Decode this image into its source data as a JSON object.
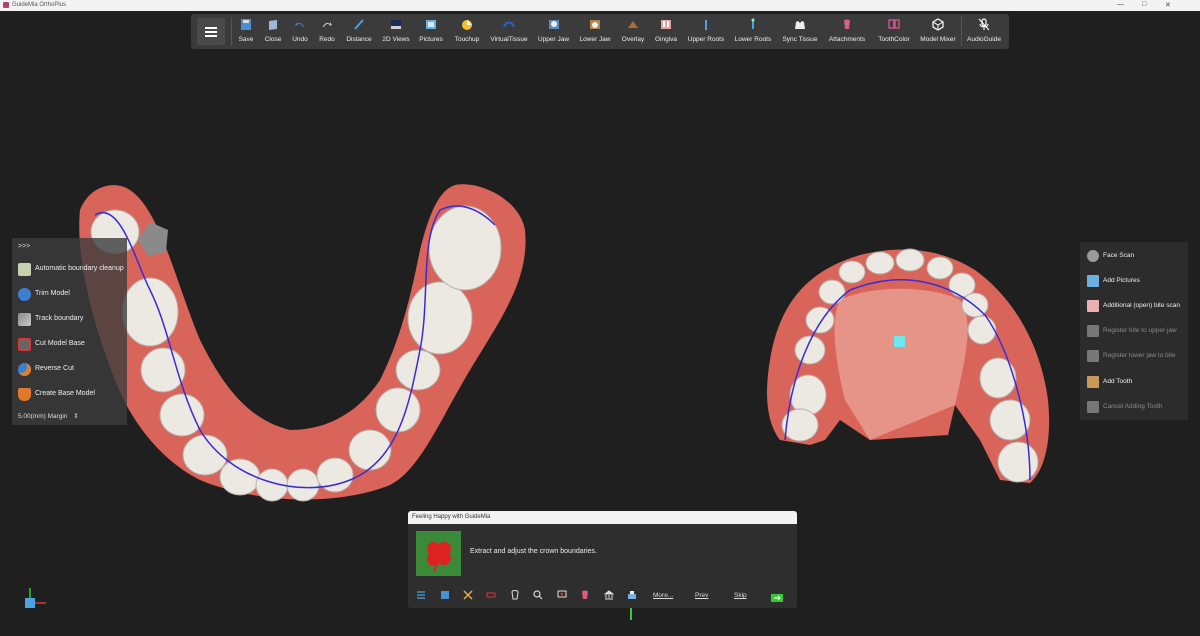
{
  "window": {
    "title": "GuideMia OrthoPlus"
  },
  "toolbar": {
    "buttons": [
      {
        "label": "Save",
        "icon": "save-icon"
      },
      {
        "label": "Close",
        "icon": "close-file-icon"
      },
      {
        "label": "Undo",
        "icon": "undo-icon"
      },
      {
        "label": "Redo",
        "icon": "redo-icon"
      },
      {
        "label": "Distance",
        "icon": "ruler-icon"
      },
      {
        "label": "2D Views",
        "icon": "2d-views-icon"
      },
      {
        "label": "Pictures",
        "icon": "pictures-icon"
      },
      {
        "label": "Touchup",
        "icon": "touchup-icon"
      },
      {
        "label": "VirtualTissue",
        "icon": "virtual-tissue-icon"
      },
      {
        "label": "Upper Jaw",
        "icon": "upper-jaw-icon"
      },
      {
        "label": "Lower Jaw",
        "icon": "lower-jaw-icon"
      },
      {
        "label": "Overlay",
        "icon": "overlay-icon"
      },
      {
        "label": "Gingiva",
        "icon": "gingiva-icon"
      },
      {
        "label": "Upper Roots",
        "icon": "upper-roots-icon"
      },
      {
        "label": "Lower Roots",
        "icon": "lower-roots-icon"
      },
      {
        "label": "Sync Tissue",
        "icon": "sync-tissue-icon"
      },
      {
        "label": "Attachments",
        "icon": "attachments-icon"
      },
      {
        "label": "ToothColor",
        "icon": "tooth-color-icon"
      },
      {
        "label": "Model Mixer",
        "icon": "model-mixer-icon"
      },
      {
        "label": "AudioGuide",
        "icon": "microphone-off-icon"
      }
    ]
  },
  "left_panel": {
    "header": ">>>",
    "items": [
      {
        "label": "Automatic boundary cleanup",
        "icon": "boundary-cleanup-icon"
      },
      {
        "label": "Trim Model",
        "icon": "trim-model-icon"
      },
      {
        "label": "Track boundary",
        "icon": "track-boundary-icon"
      },
      {
        "label": "Cut Model Base",
        "icon": "cut-base-icon"
      },
      {
        "label": "Reverse Cut",
        "icon": "reverse-cut-icon"
      },
      {
        "label": "Create Base Model",
        "icon": "create-base-icon"
      }
    ],
    "margin": "5.00(mm) Margin"
  },
  "right_panel": {
    "items": [
      {
        "label": "Face Scan",
        "icon": "face-scan-icon",
        "enabled": true
      },
      {
        "label": "Add Pictures",
        "icon": "add-pictures-icon",
        "enabled": true
      },
      {
        "label": "Additional (open) bite scan",
        "icon": "bite-scan-icon",
        "enabled": true
      },
      {
        "label": "Register bite to upper jaw",
        "icon": "register-upper-icon",
        "enabled": false
      },
      {
        "label": "Register lower jaw to bite",
        "icon": "register-lower-icon",
        "enabled": false
      },
      {
        "label": "Add Tooth",
        "icon": "add-tooth-icon",
        "enabled": true
      },
      {
        "label": "Cancel Adding Tooth",
        "icon": "cancel-tooth-icon",
        "enabled": false
      }
    ]
  },
  "guide": {
    "title": "Feeling Happy with GuideMia",
    "message": "Extract and adjust the crown boundaries.",
    "links": {
      "more": "More...",
      "prev": "Prev",
      "skip": "Skip"
    }
  },
  "colors": {
    "background": "#1f1f1f",
    "toolbar": "#3b3b3b",
    "gum": "#d9645a",
    "tooth": "#ece8e2",
    "boundary": "#3b2bd6"
  }
}
